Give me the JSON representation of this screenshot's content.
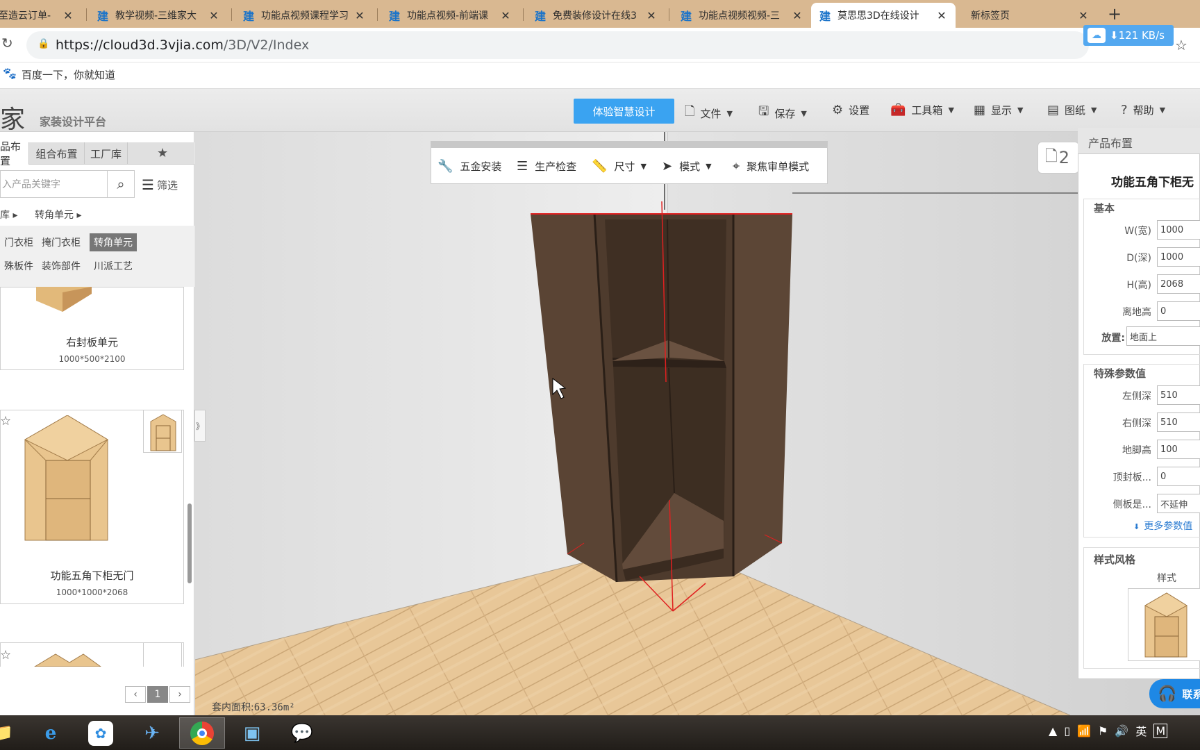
{
  "browser": {
    "tabs": [
      {
        "label": "至造云订单-",
        "icon": "建"
      },
      {
        "label": "教学视频-三维家大",
        "icon": "建"
      },
      {
        "label": "功能点视频课程学习",
        "icon": "建"
      },
      {
        "label": "功能点视频-前端课",
        "icon": "建"
      },
      {
        "label": "免费装修设计在线3",
        "icon": "建"
      },
      {
        "label": "功能点视频视频-三",
        "icon": "建"
      },
      {
        "label": "莫思思3D在线设计",
        "icon": "建"
      },
      {
        "label": "新标签页",
        "icon": ""
      }
    ],
    "close_glyph": "✕",
    "new_tab_glyph": "+",
    "url_host": "https://cloud3d.3vjia.com",
    "url_path": "/3D/V2/Index",
    "net_speed": "⬇121 KB/s",
    "bookmark": "百度一下，你就知道"
  },
  "app": {
    "logo_char": "家",
    "logo_text": "家装设计平台",
    "smart_button": "体验智慧设计",
    "menus": [
      {
        "label": "文件",
        "icon": "🗋"
      },
      {
        "label": "保存",
        "icon": "🖫"
      },
      {
        "label": "设置",
        "icon": "⚙"
      },
      {
        "label": "工具箱",
        "icon": "🧰"
      },
      {
        "label": "显示",
        "icon": "▦"
      },
      {
        "label": "图纸",
        "icon": "▤"
      },
      {
        "label": "帮助",
        "icon": "?"
      }
    ]
  },
  "left_panel": {
    "tabs": [
      "品布置",
      "组合布置",
      "工厂库"
    ],
    "search_placeholder": "入产品关键字",
    "filter_label": "筛选",
    "breadcrumbs": [
      "库",
      "转角单元"
    ],
    "categories_row1": [
      "门衣柜",
      "掩门衣柜",
      "转角单元"
    ],
    "categories_row2": [
      "殊板件",
      "装饰部件",
      "川派工艺"
    ],
    "products": [
      {
        "name": "右封板单元",
        "dims": "1000*500*2100"
      },
      {
        "name": "功能五角下柜无门",
        "dims": "1000*1000*2068"
      }
    ],
    "page": "1",
    "prev": "‹",
    "next": "›",
    "collapse": "》"
  },
  "viewport": {
    "tools": [
      {
        "label": "五金安装",
        "icon": "🔧",
        "caret": false
      },
      {
        "label": "生产检查",
        "icon": "☰",
        "caret": false
      },
      {
        "label": "尺寸",
        "icon": "📏",
        "caret": true
      },
      {
        "label": "模式",
        "icon": "➤",
        "caret": true
      },
      {
        "label": "聚焦审单模式",
        "icon": "⌖",
        "caret": false
      }
    ],
    "view_badge": "2",
    "area_label": "套内面积:",
    "area_value": "63.36m²"
  },
  "right_panel": {
    "title": "产品布置",
    "product_name": "功能五角下柜无",
    "section_basic": "基本",
    "basic_fields": [
      {
        "label": "W(宽)",
        "value": "1000"
      },
      {
        "label": "D(深)",
        "value": "1000"
      },
      {
        "label": "H(高)",
        "value": "2068"
      },
      {
        "label": "离地高",
        "value": "0"
      }
    ],
    "place_label": "放置:",
    "place_value": "地面上",
    "section_special": "特殊参数值",
    "special_fields": [
      {
        "label": "左侧深",
        "value": "510"
      },
      {
        "label": "右侧深",
        "value": "510"
      },
      {
        "label": "地脚高",
        "value": "100"
      },
      {
        "label": "顶封板...",
        "value": "0"
      },
      {
        "label": "侧板是...",
        "value": "不延伸"
      }
    ],
    "more_params": "更多参数值",
    "section_style": "样式风格",
    "style_label": "样式",
    "contact": "联系"
  },
  "taskbar": {
    "tray_lang": "英",
    "tray_m": "M"
  },
  "colors": {
    "accent": "#3aa3f1",
    "tab_bar": "#d9b891",
    "cabinet": "#5a4434"
  }
}
